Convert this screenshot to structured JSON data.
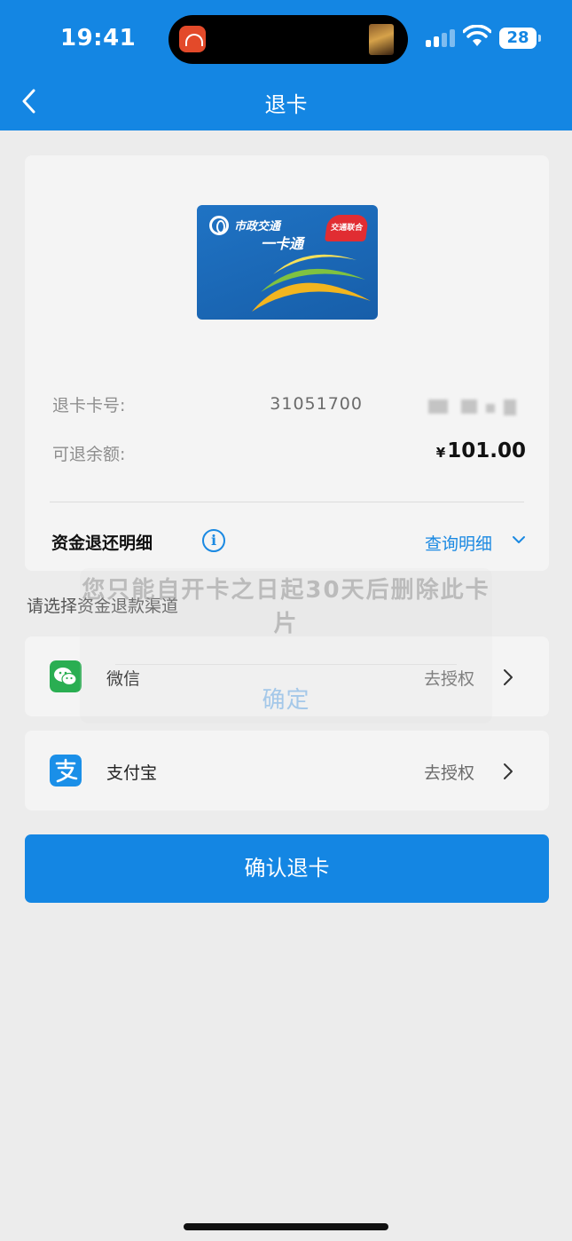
{
  "status_bar": {
    "time": "19:41",
    "battery": "28"
  },
  "nav": {
    "title": "退卡"
  },
  "card": {
    "brand_text": "市政交通",
    "product_text": "一卡通",
    "badge_text": "交通联合",
    "card_number_label": "退卡卡号:",
    "card_number_value": "31051700",
    "refundable_label": "可退余额:",
    "currency_symbol": "¥",
    "refundable_amount": "101.00"
  },
  "refund_detail": {
    "title": "资金退还明细",
    "info_glyph": "i",
    "query_label": "查询明细"
  },
  "channels": {
    "section_label": "请选择资金退款渠道",
    "items": [
      {
        "name": "微信",
        "action": "去授权",
        "icon": "wechat-icon",
        "color": "#2aae52"
      },
      {
        "name": "支付宝",
        "action": "去授权",
        "icon": "alipay-icon",
        "color": "#1a8fe8"
      }
    ]
  },
  "confirm_button": "确认退卡",
  "dialog": {
    "message": "您只能自开卡之日起30天后删除此卡片",
    "confirm": "确定"
  },
  "colors": {
    "primary": "#1486e3",
    "link": "#1a89e2",
    "background": "#ececec",
    "panel": "#f4f4f4"
  }
}
